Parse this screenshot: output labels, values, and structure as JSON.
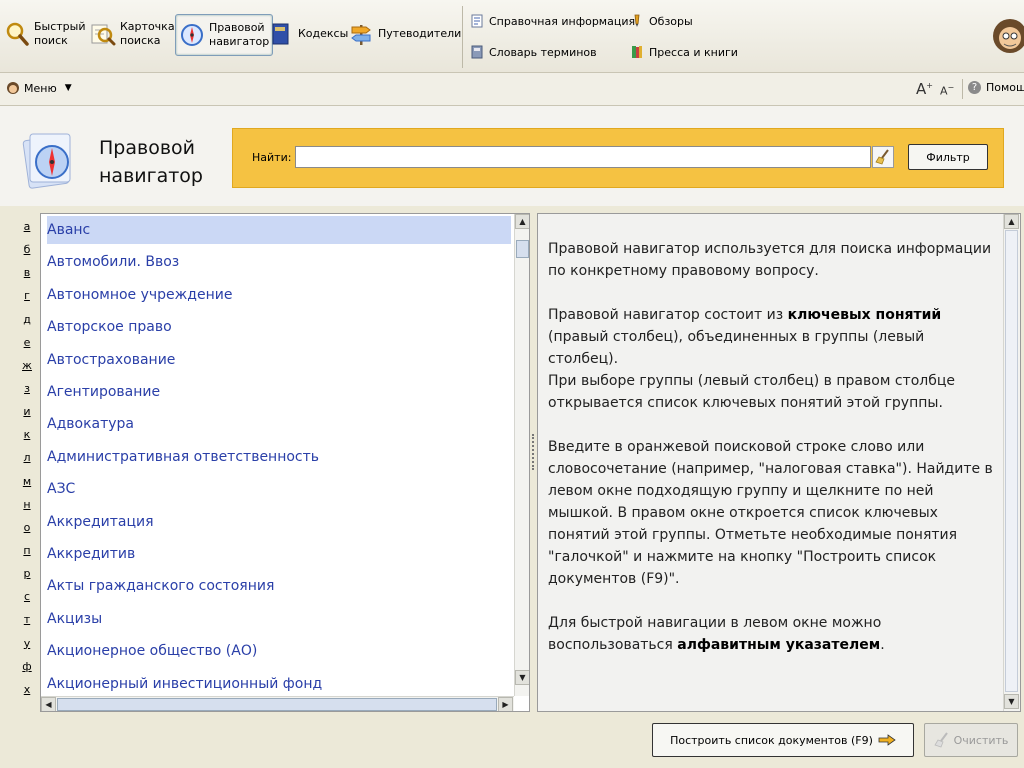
{
  "toolbar": {
    "quick_search": "Быстрый\nпоиск",
    "card_search": "Карточка\nпоиска",
    "legal_navigator": "Правовой\nнавигатор",
    "codes": "Кодексы",
    "guides": "Путеводители",
    "reference_info": "Справочная информация",
    "reviews": "Обзоры",
    "glossary": "Словарь терминов",
    "press_books": "Пресса и книги"
  },
  "menubar": {
    "menu_label": "Меню",
    "help_label": "Помощь"
  },
  "header": {
    "title": "Правовой\nнавигатор"
  },
  "search": {
    "label": "Найти:",
    "value": "",
    "filter_label": "Фильтр"
  },
  "alphabet": [
    "а",
    "б",
    "в",
    "г",
    "д",
    "е",
    "ж",
    "з",
    "и",
    "к",
    "л",
    "м",
    "н",
    "о",
    "п",
    "р",
    "с",
    "т",
    "у",
    "ф",
    "х"
  ],
  "list": {
    "selected_index": 0,
    "items": [
      "Аванс",
      "Автомобили. Ввоз",
      "Автономное учреждение",
      "Авторское право",
      "Автострахование",
      "Агентирование",
      "Адвокатура",
      "Административная ответственность",
      "АЗС",
      "Аккредитация",
      "Аккредитив",
      "Акты гражданского состояния",
      "Акцизы",
      "Акционерное общество (АО)",
      "Акционерный инвестиционный фонд"
    ]
  },
  "info": {
    "p1": "Правовой навигатор используется для поиска информации по конкретному правовому вопросу.",
    "p2a": "Правовой навигатор состоит из ",
    "p2b": "ключевых понятий",
    "p2c": " (правый столбец), объединенных в группы (левый столбец).",
    "p3": "При выборе группы (левый столбец) в правом столбце открывается список ключевых понятий этой группы.",
    "p4": "Введите в оранжевой поисковой строке слово или словосочетание (например, \"налоговая ставка\"). Найдите в левом окне подходящую группу и щелкните по ней мышкой. В правом окне откроется список ключевых понятий этой группы. Отметьте необходимые понятия \"галочкой\" и нажмите на кнопку \"Построить список документов (F9)\".",
    "p5a": "Для быстрой навигации в левом окне можно воспользоваться ",
    "p5b": "алфавитным указателем",
    "p5c": "."
  },
  "bottom": {
    "build_label": "Построить список документов (F9)",
    "clear_label": "Очистить"
  }
}
